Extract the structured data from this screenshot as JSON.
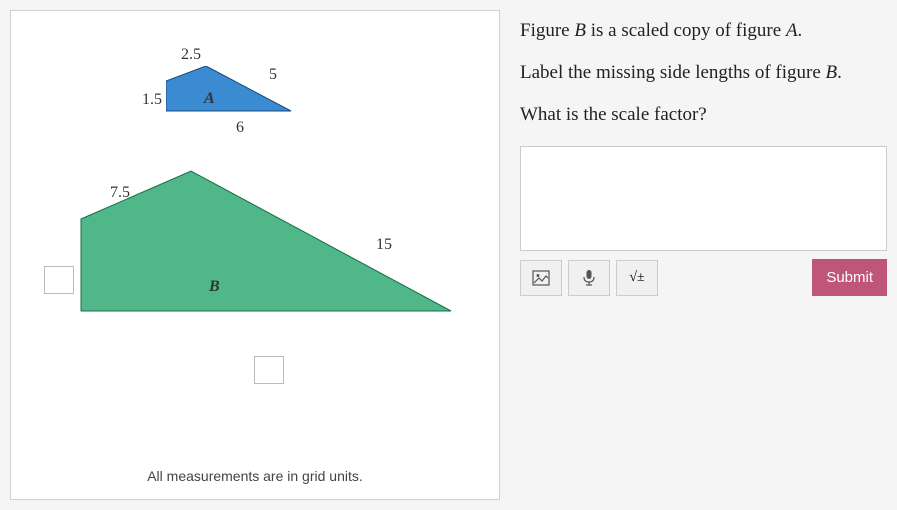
{
  "question": {
    "line1_pre": "Figure ",
    "line1_var": "B",
    "line1_mid": " is a scaled copy of figure ",
    "line1_var2": "A",
    "line1_end": ".",
    "line2_pre": "Label the missing side lengths of figure ",
    "line2_var": "B",
    "line2_end": ".",
    "line3": "What is the scale factor?"
  },
  "figureA": {
    "label": "A",
    "side_top_left": "2.5",
    "side_top_right": "5",
    "side_left": "1.5",
    "side_bottom": "6"
  },
  "figureB": {
    "label": "B",
    "side_top_left": "7.5",
    "side_top_right": "15"
  },
  "footer": "All measurements are in grid units.",
  "toolbar": {
    "sqrt_label": "√±",
    "submit_label": "Submit"
  },
  "chart_data": {
    "type": "diagram",
    "figures": [
      {
        "name": "A",
        "color": "#3a8bd2",
        "sides": [
          {
            "position": "top-left",
            "length": 2.5
          },
          {
            "position": "top-right",
            "length": 5
          },
          {
            "position": "left",
            "length": 1.5
          },
          {
            "position": "bottom",
            "length": 6
          }
        ]
      },
      {
        "name": "B",
        "color": "#4fb788",
        "sides": [
          {
            "position": "top-left",
            "length": 7.5
          },
          {
            "position": "top-right",
            "length": 15
          },
          {
            "position": "left",
            "length": null
          },
          {
            "position": "bottom",
            "length": null
          }
        ]
      }
    ],
    "note": "All measurements are in grid units."
  }
}
